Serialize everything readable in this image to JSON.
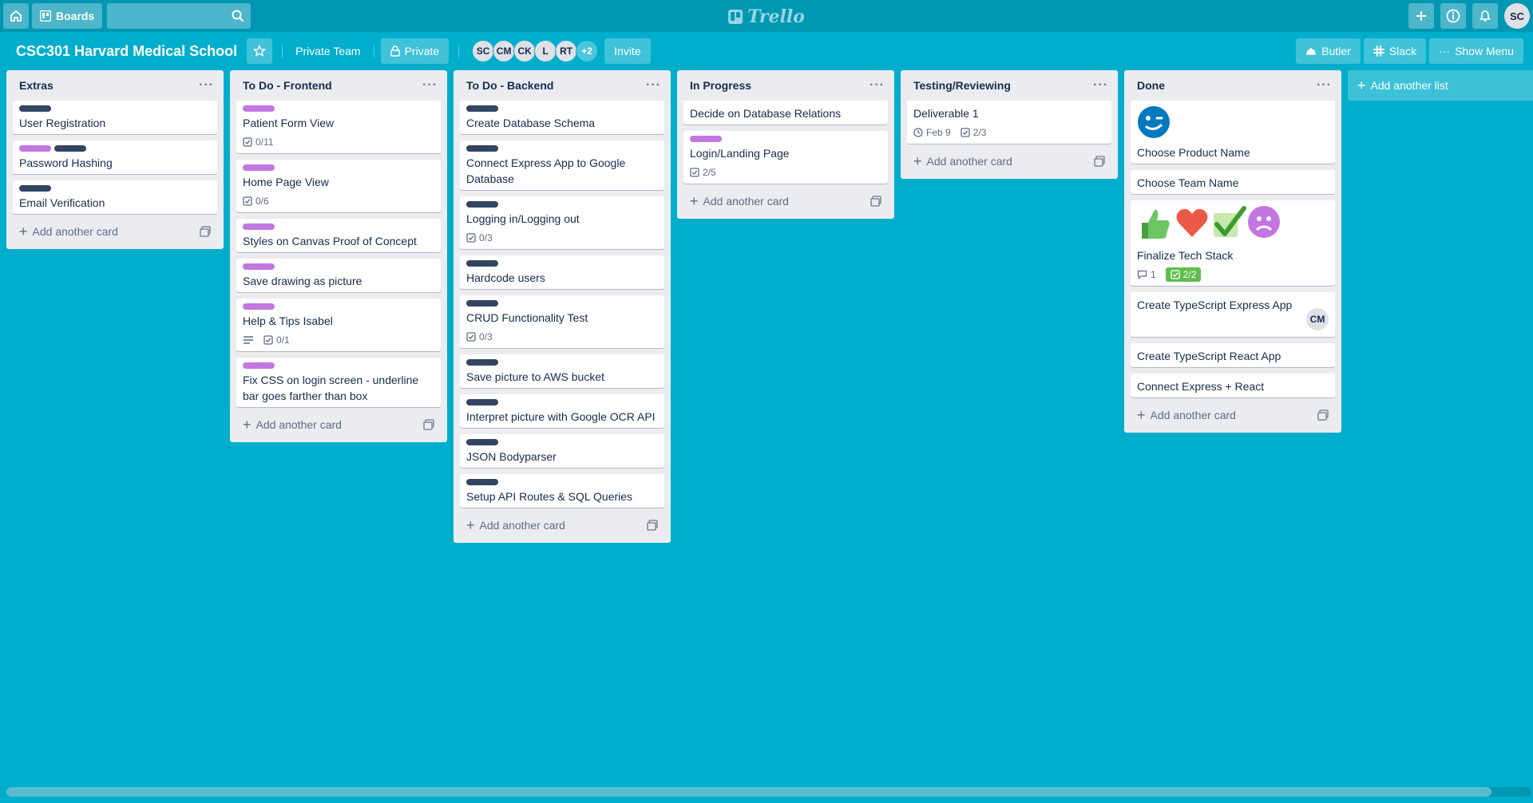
{
  "topbar": {
    "boards_label": "Boards",
    "search_value": "",
    "logo_text": "Trello",
    "user_initials": "SC"
  },
  "board": {
    "title": "CSC301 Harvard Medical School",
    "team_label": "Private Team",
    "visibility_label": "Private",
    "members": [
      "SC",
      "CM",
      "CK",
      "L",
      "RT"
    ],
    "more_members": "+2",
    "invite_label": "Invite",
    "butler_label": "Butler",
    "slack_label": "Slack",
    "menu_label": "Show Menu"
  },
  "add_card_label": "Add another card",
  "add_list_label": "Add another list",
  "lists": [
    {
      "title": "Extras",
      "cards": [
        {
          "title": "User Registration",
          "labels": [
            "dark"
          ]
        },
        {
          "title": "Password Hashing",
          "labels": [
            "purple",
            "dark"
          ]
        },
        {
          "title": "Email Verification",
          "labels": [
            "dark"
          ]
        }
      ]
    },
    {
      "title": "To Do - Frontend",
      "cards": [
        {
          "title": "Patient Form View",
          "labels": [
            "purple"
          ],
          "checklist": "0/11"
        },
        {
          "title": "Home Page View",
          "labels": [
            "purple"
          ],
          "checklist": "0/6"
        },
        {
          "title": "Styles on Canvas Proof of Concept",
          "labels": [
            "purple"
          ]
        },
        {
          "title": "Save drawing as picture",
          "labels": [
            "purple"
          ]
        },
        {
          "title": "Help & Tips Isabel",
          "labels": [
            "purple"
          ],
          "description": true,
          "checklist": "0/1"
        },
        {
          "title": "Fix CSS on login screen - underline bar goes farther than box",
          "labels": [
            "purple"
          ]
        }
      ]
    },
    {
      "title": "To Do - Backend",
      "cards": [
        {
          "title": "Create Database Schema",
          "labels": [
            "dark"
          ]
        },
        {
          "title": "Connect Express App to Google Database",
          "labels": [
            "dark"
          ]
        },
        {
          "title": "Logging in/Logging out",
          "labels": [
            "dark"
          ],
          "checklist": "0/3"
        },
        {
          "title": "Hardcode users",
          "labels": [
            "dark"
          ]
        },
        {
          "title": "CRUD Functionality Test",
          "labels": [
            "dark"
          ],
          "checklist": "0/3"
        },
        {
          "title": "Save picture to AWS bucket",
          "labels": [
            "dark"
          ]
        },
        {
          "title": "Interpret picture with Google OCR API",
          "labels": [
            "dark"
          ]
        },
        {
          "title": "JSON Bodyparser",
          "labels": [
            "dark"
          ]
        },
        {
          "title": "Setup API Routes & SQL Queries",
          "labels": [
            "dark"
          ]
        }
      ]
    },
    {
      "title": "In Progress",
      "cards": [
        {
          "title": "Decide on Database Relations",
          "labels": []
        },
        {
          "title": "Login/Landing Page",
          "labels": [
            "purple"
          ],
          "checklist": "2/5"
        }
      ]
    },
    {
      "title": "Testing/Reviewing",
      "cards": [
        {
          "title": "Deliverable 1",
          "labels": [],
          "due": "Feb 9",
          "checklist": "2/3"
        }
      ]
    },
    {
      "title": "Done",
      "cards": [
        {
          "title": "Choose Product Name",
          "labels": [],
          "stickers": [
            "wink-face-icon"
          ]
        },
        {
          "title": "Choose Team Name",
          "labels": []
        },
        {
          "title": "Finalize Tech Stack",
          "labels": [],
          "stickers": [
            "thumbs-up-icon",
            "heart-icon",
            "check-icon",
            "worried-face-icon"
          ],
          "comments": "1",
          "checklist_done": "2/2"
        },
        {
          "title": "Create TypeScript Express App",
          "labels": [],
          "member": "CM"
        },
        {
          "title": "Create TypeScript React App",
          "labels": []
        },
        {
          "title": "Connect Express + React",
          "labels": []
        }
      ]
    }
  ],
  "colors": {
    "board_bg": "#00aecc",
    "header_bg": "#0097b3",
    "label_dark": "#344563",
    "label_purple": "#c377e0",
    "checklist_done": "#61bd4f"
  }
}
